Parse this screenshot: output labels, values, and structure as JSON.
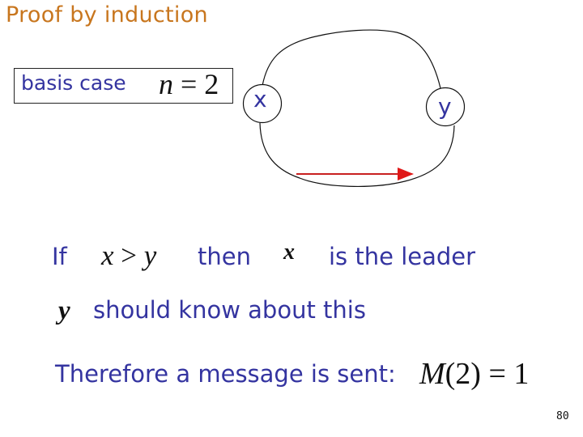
{
  "slide": {
    "title": "Proof by induction",
    "basis": {
      "label": "basis case",
      "math_var": "n",
      "math_rest": " = 2"
    },
    "diagram": {
      "nodes": [
        {
          "label": "x"
        },
        {
          "label": "y"
        }
      ],
      "arrow_color": "#d42020"
    },
    "line1": {
      "if": "If",
      "cond_x": "x",
      "cond_op": " > ",
      "cond_y": "y",
      "then": "then",
      "leader_var": "x",
      "leader_text": "is the leader"
    },
    "line2": {
      "var": "y",
      "text": "should know about this"
    },
    "line3": {
      "text": "Therefore a message is sent:",
      "math_M": "M",
      "math_rest": "(2) = 1"
    },
    "page_number": "80",
    "colors": {
      "title": "#c8761e",
      "body_text": "#3434a0"
    }
  }
}
